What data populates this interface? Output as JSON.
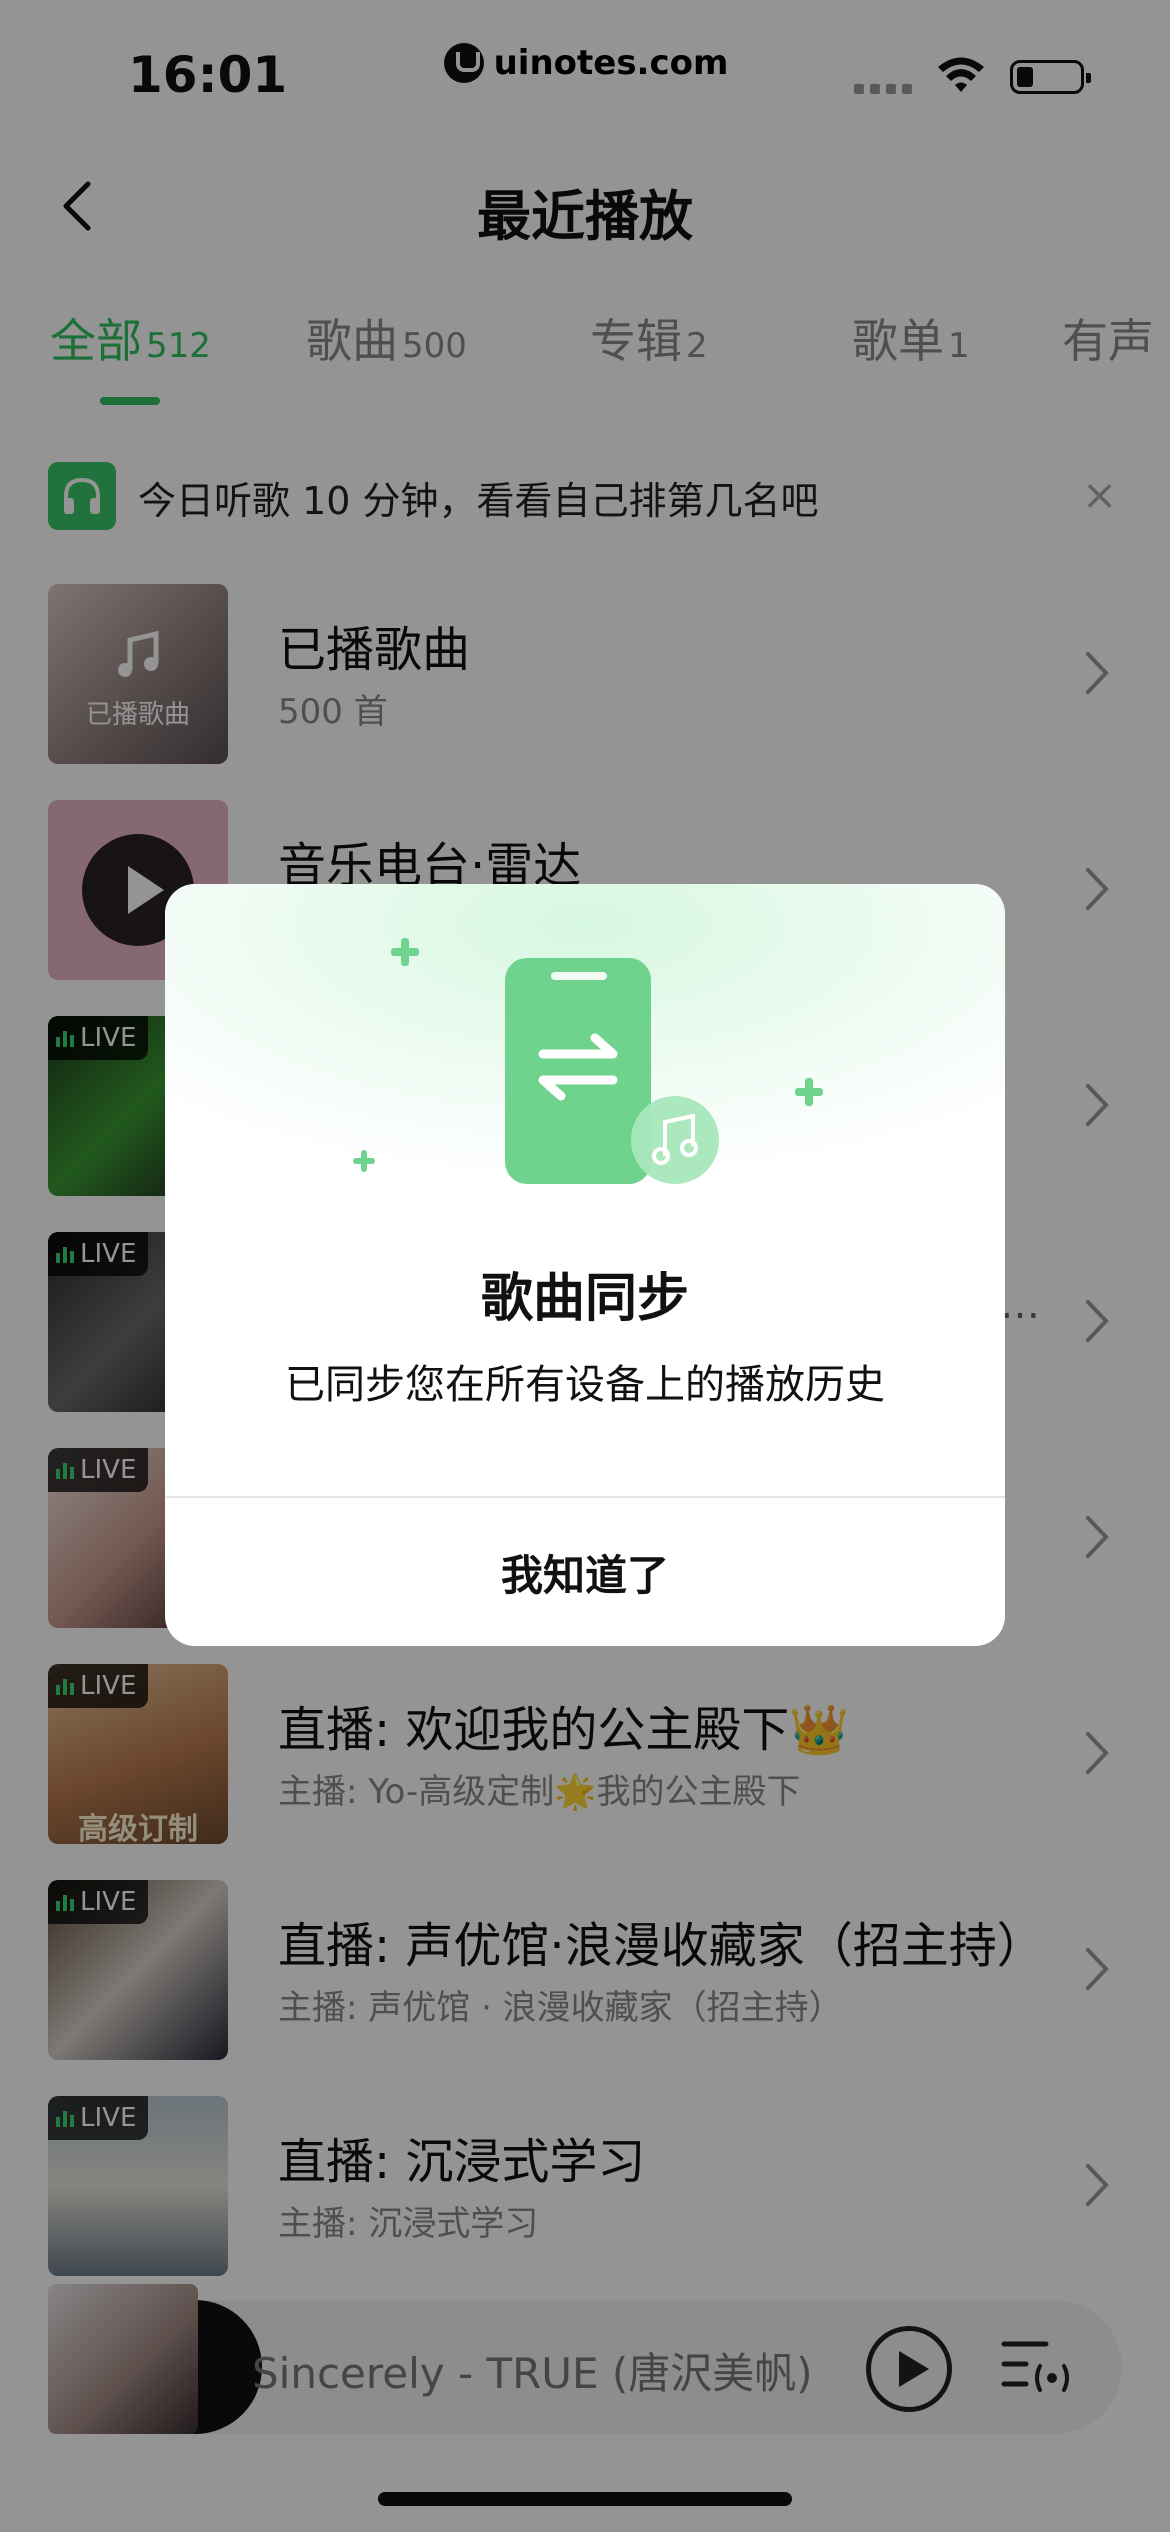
{
  "status_bar": {
    "time": "16:01",
    "watermark": "uinotes.com"
  },
  "header": {
    "title": "最近播放",
    "back_icon": "chevron-left-icon"
  },
  "tabs": [
    {
      "label": "全部",
      "count": "512",
      "active": true
    },
    {
      "label": "歌曲",
      "count": "500",
      "active": false
    },
    {
      "label": "专辑",
      "count": "2",
      "active": false
    },
    {
      "label": "歌单",
      "count": "1",
      "active": false
    },
    {
      "label": "有声",
      "count": "",
      "active": false
    }
  ],
  "banner": {
    "text": "今日听歌 10 分钟，看看自己排第几名吧",
    "icon": "headphones-icon",
    "close": "×"
  },
  "list": [
    {
      "title": "已播歌曲",
      "subtitle": "500 首",
      "thumb_label": "已播歌曲",
      "live": false
    },
    {
      "title": "音乐电台·雷达",
      "subtitle": "",
      "live": false
    },
    {
      "title": "",
      "subtitle": "",
      "live": true
    },
    {
      "title": "",
      "subtitle": "…",
      "live": true
    },
    {
      "title": "",
      "subtitle": "",
      "live": true
    },
    {
      "title": "直播: 欢迎我的公主殿下👑",
      "subtitle": "主播: Yo-高级定制🌟我的公主殿下",
      "thumb_text": "高级订制",
      "live": true
    },
    {
      "title": "直播: 声优馆·浪漫收藏家（招主持）",
      "subtitle": "主播: 声优馆 · 浪漫收藏家（招主持）",
      "live": true
    },
    {
      "title": "直播: 沉浸式学习",
      "subtitle": "主播: 沉浸式学习",
      "live": true
    }
  ],
  "live_label": "LIVE",
  "player": {
    "track": "Sincerely - TRUE (唐沢美帆)"
  },
  "modal": {
    "title": "歌曲同步",
    "description": "已同步您在所有设备上的播放历史",
    "button": "我知道了"
  },
  "colors": {
    "accent": "#2fbf5f",
    "overlay": "rgba(0,0,0,0.42)"
  }
}
